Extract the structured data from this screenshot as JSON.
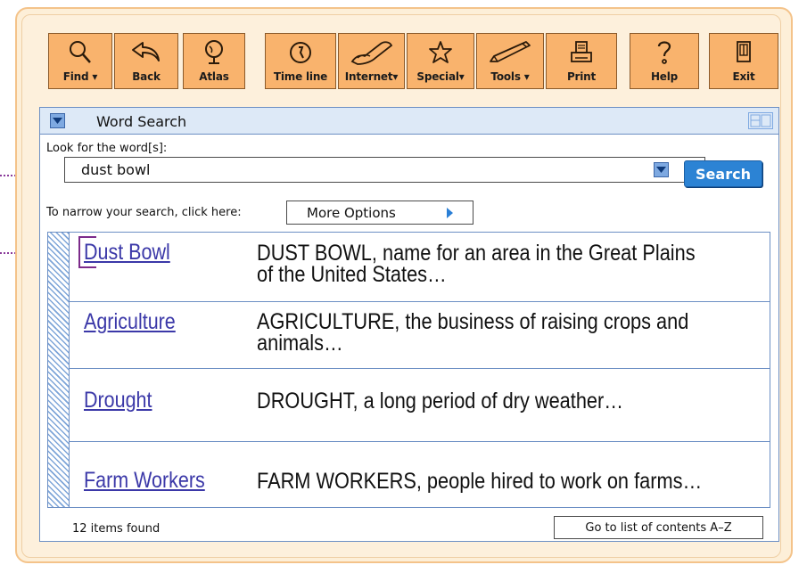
{
  "toolbar": {
    "find": "Find",
    "back": "Back",
    "atlas": "Atlas",
    "timeline": "Time line",
    "internet": "Internet",
    "special": "Special",
    "tools": "Tools",
    "print": "Print",
    "help": "Help",
    "exit": "Exit"
  },
  "window": {
    "title": "Word Search"
  },
  "search": {
    "label": "Look for the word[s]:",
    "value": "dust bowl",
    "button": "Search"
  },
  "narrow": {
    "label": "To narrow your search, click here:",
    "button": "More Options"
  },
  "results": [
    {
      "title": "Dust Bowl",
      "line1": "DUST BOWL, name for an area in the Great Plains",
      "line2": "of the United States…"
    },
    {
      "title": "Agriculture",
      "line1": "AGRICULTURE, the business of raising crops and",
      "line2": "animals…"
    },
    {
      "title": "Drought",
      "line1": "DROUGHT, a long period of dry weather…",
      "line2": ""
    },
    {
      "title": "Farm Workers",
      "line1": "FARM WORKERS, people hired to work on farms…",
      "line2": ""
    }
  ],
  "footer": {
    "count": "12 items found",
    "goto": "Go to list of contents A–Z"
  },
  "colors": {
    "frame": "#fdefd8",
    "toolbar_button": "#f9b36d",
    "accent_blue": "#2c83d4",
    "link": "#3b38a8",
    "annotation": "#8a3a9a"
  },
  "icons": [
    "find-icon",
    "back-icon",
    "atlas-icon",
    "timeline-icon",
    "internet-icon",
    "special-icon",
    "tools-icon",
    "print-icon",
    "help-icon",
    "exit-icon"
  ]
}
